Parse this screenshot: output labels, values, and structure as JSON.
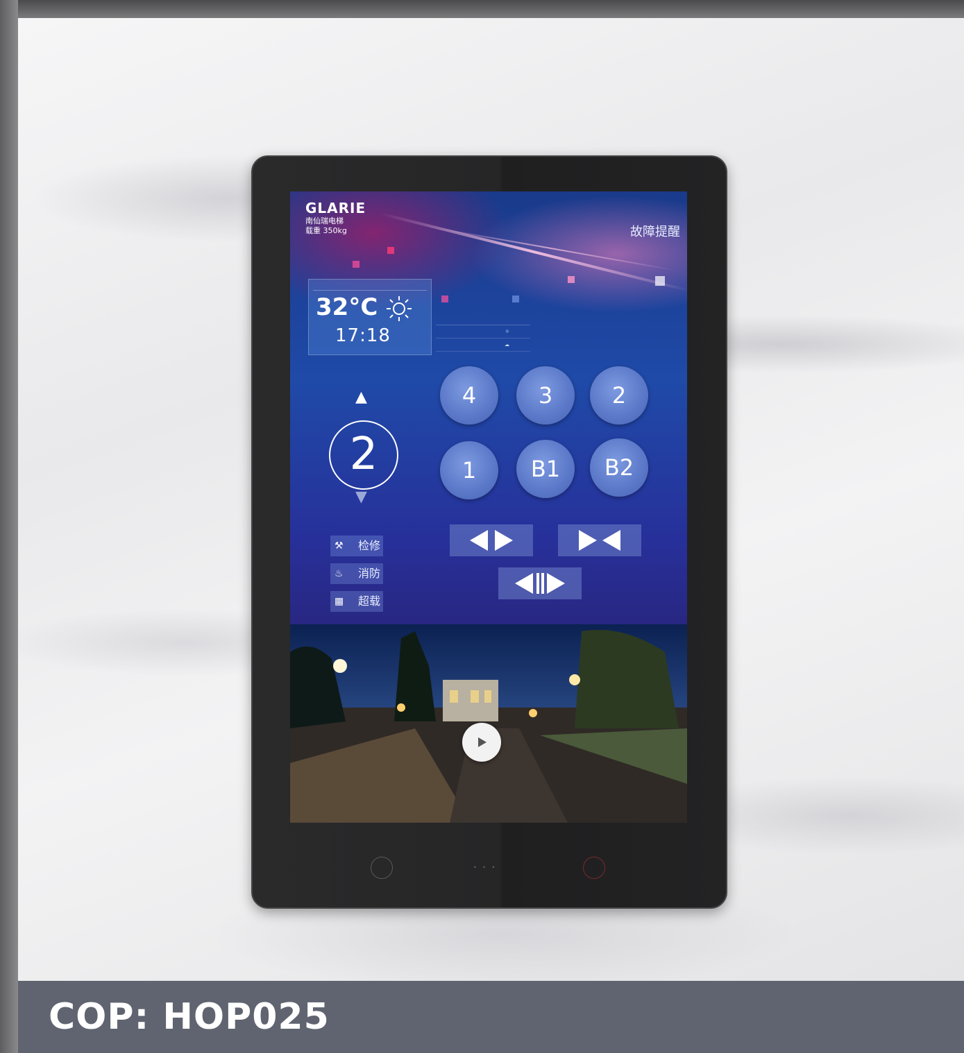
{
  "brand": {
    "logo_text": "GLARIE",
    "sub_name": "南仙瑞电梯",
    "load_label": "载重 350kg"
  },
  "status": {
    "fault_reminder": "故障提醒"
  },
  "weather": {
    "temperature": "32°C",
    "time": "17:18",
    "condition_icon": "sun-icon"
  },
  "indicator": {
    "current_floor": "2",
    "direction_up_icon": "arrow-up-icon",
    "direction_down_icon": "arrow-down-icon"
  },
  "floor_buttons": [
    {
      "label": "4"
    },
    {
      "label": "3"
    },
    {
      "label": "2"
    },
    {
      "label": "1"
    },
    {
      "label": "B1"
    },
    {
      "label": "B2"
    }
  ],
  "modes": [
    {
      "label": "检修",
      "icon": "tools-icon"
    },
    {
      "label": "消防",
      "icon": "fire-extinguisher-icon"
    },
    {
      "label": "超载",
      "icon": "overload-icon"
    }
  ],
  "door_controls": [
    {
      "name": "door-open-button",
      "icon": "door-open-icon"
    },
    {
      "name": "door-close-button",
      "icon": "door-close-icon"
    },
    {
      "name": "door-hold-button",
      "icon": "door-hold-icon"
    }
  ],
  "media": {
    "play_icon": "play-icon"
  },
  "caption": {
    "model": "COP: HOP025"
  },
  "colors": {
    "footer_bar": "#5f6470",
    "screen_blue": "#1f4aa8",
    "accent_pink": "#ff50a0"
  }
}
